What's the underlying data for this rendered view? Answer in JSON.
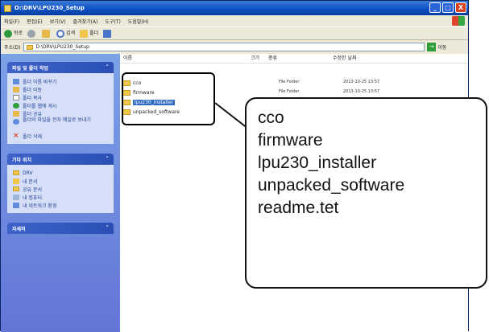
{
  "window": {
    "title": "D:\\DRV\\LPU230_Setup",
    "minimize_glyph": "_",
    "maximize_glyph": "□",
    "close_glyph": "X"
  },
  "menubar": {
    "items": [
      "파일(F)",
      "편집(E)",
      "보기(V)",
      "즐겨찾기(A)",
      "도구(T)",
      "도움말(H)"
    ]
  },
  "toolbar": {
    "back": "뒤로",
    "search": "검색",
    "folders": "폴더"
  },
  "address": {
    "label": "주소(D)",
    "value": "D:\\DRV\\LPU230_Setup",
    "go": "이동"
  },
  "sidebar": {
    "tasks": {
      "header": "파일 및 폴더 작업",
      "items": [
        "폴더 이름 바꾸기",
        "폴더 이동",
        "폴더 복사",
        "폴더를 웹에 게시",
        "폴더 공유",
        "폴더의 파일을 전자 메일로 보내기",
        "폴더 삭제"
      ]
    },
    "places": {
      "header": "기타 위치",
      "items": [
        "DRV",
        "내 문서",
        "공유 문서",
        "내 컴퓨터",
        "내 네트워크 환경"
      ]
    },
    "details": {
      "header": "자세히"
    }
  },
  "filelist": {
    "columns": [
      "이름",
      "크기",
      "종류",
      "수정한 날짜"
    ],
    "rows": [
      {
        "name": "cco",
        "type": "File Folder",
        "date": "2013-10-25 13:57"
      },
      {
        "name": "firmware",
        "type": "File Folder",
        "date": "2013-10-25 13:57"
      },
      {
        "name": "lpu230_installer",
        "type": "",
        "date": ""
      },
      {
        "name": "unpacked_software",
        "type": "",
        "date": ""
      }
    ]
  },
  "callout": {
    "lines": [
      "cco",
      "firmware",
      "lpu230_installer",
      "unpacked_software",
      "readme.tet"
    ]
  },
  "colors": {
    "titlebar": "#0b4fc4",
    "sidebar": "#6f8ce0",
    "selection": "#316ac5",
    "folder": "#f1c64d"
  }
}
